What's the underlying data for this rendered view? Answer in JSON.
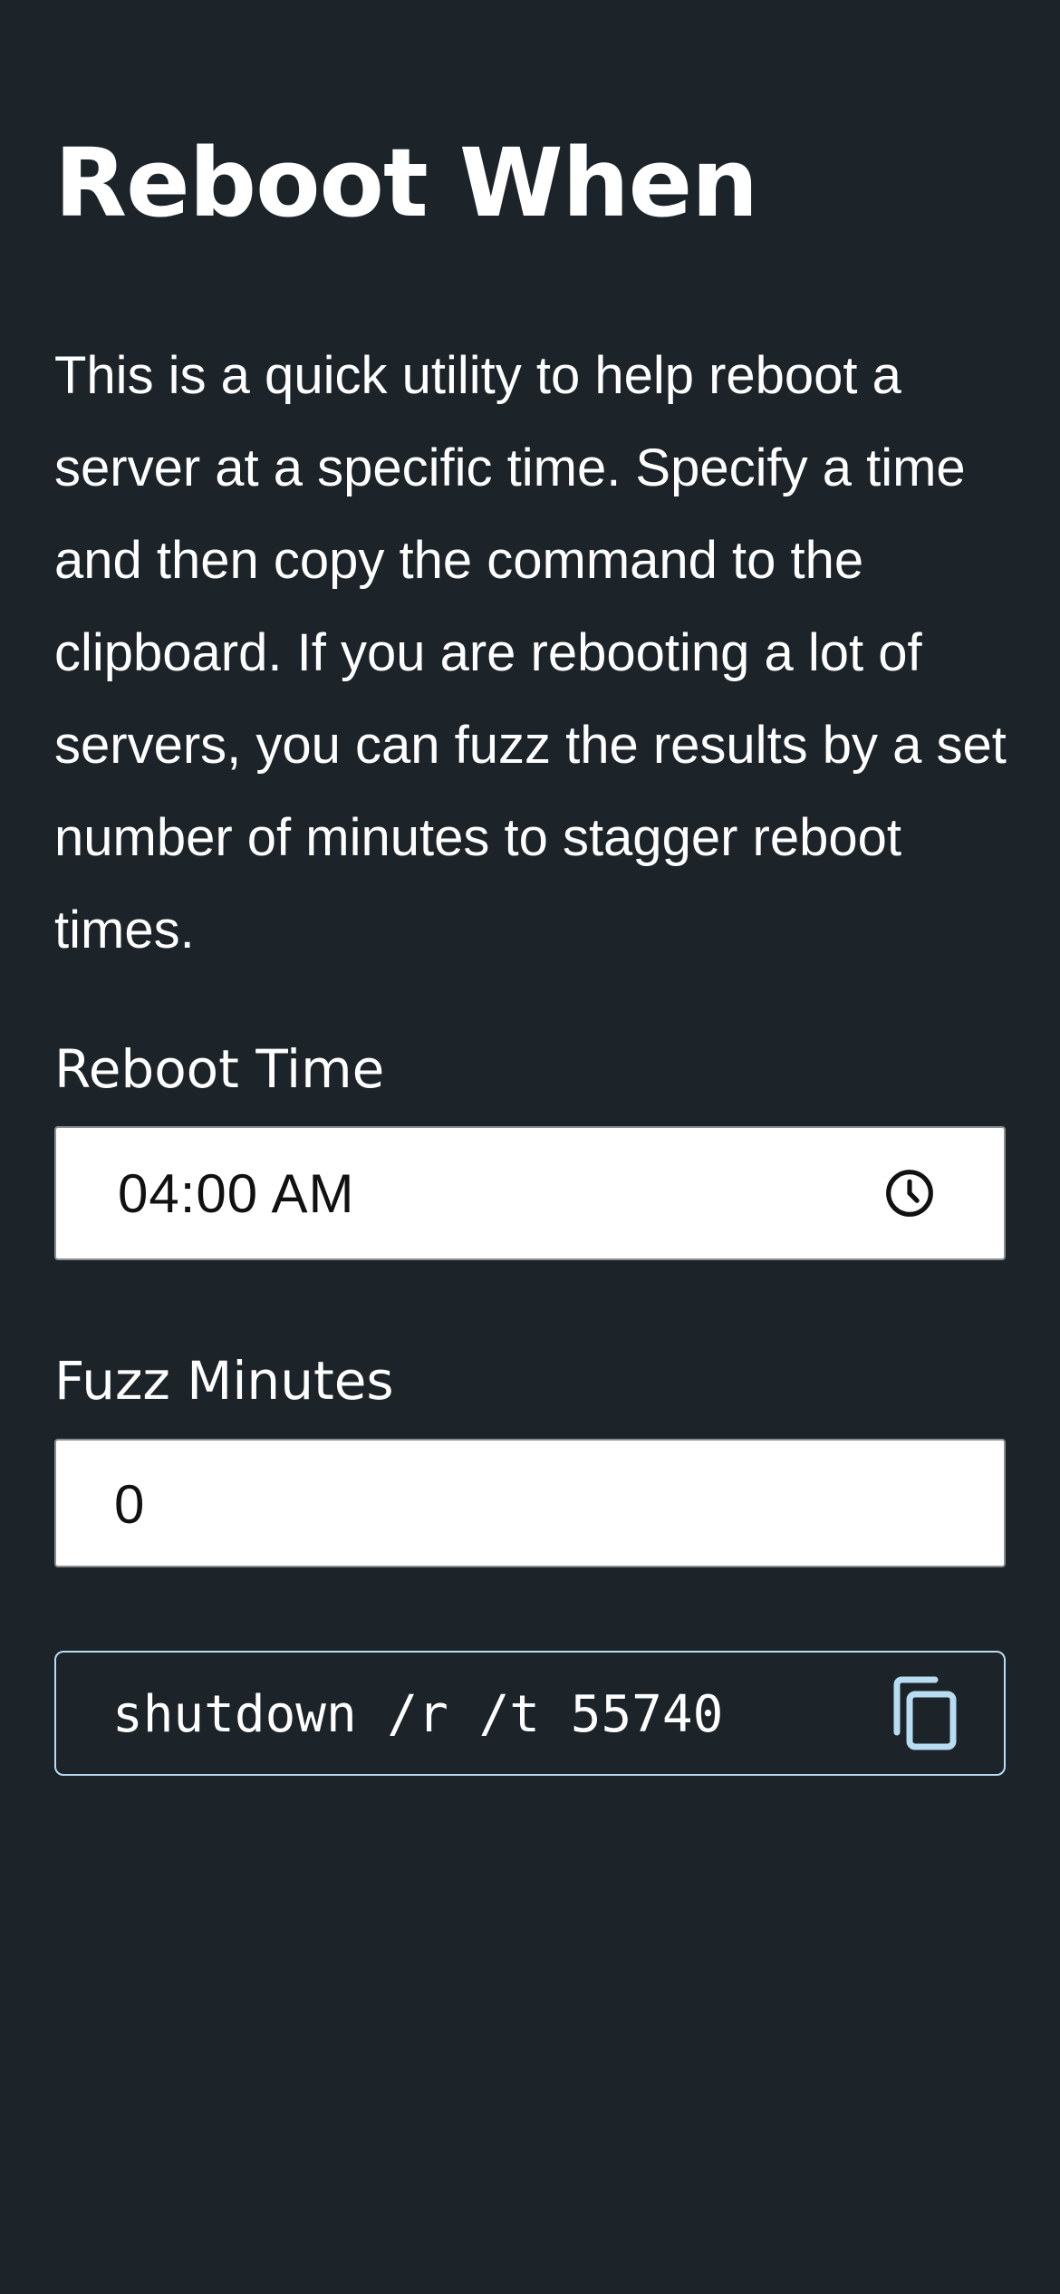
{
  "page": {
    "title": "Reboot When",
    "description": "This is a quick utility to help reboot a server at a specific time. Specify a time and then copy the command to the clipboard. If you are rebooting a lot of servers, you can fuzz the results by a set number of minutes to stagger reboot times."
  },
  "reboot_time": {
    "label": "Reboot Time",
    "value": "04:00  AM",
    "icon": "clock-icon"
  },
  "fuzz_minutes": {
    "label": "Fuzz Minutes",
    "value": "0"
  },
  "command": {
    "text": "shutdown /r /t 55740",
    "icon": "copy-icon"
  },
  "colors": {
    "background": "#1c2429",
    "text": "#ffffff",
    "accent": "#b8dcf2"
  }
}
